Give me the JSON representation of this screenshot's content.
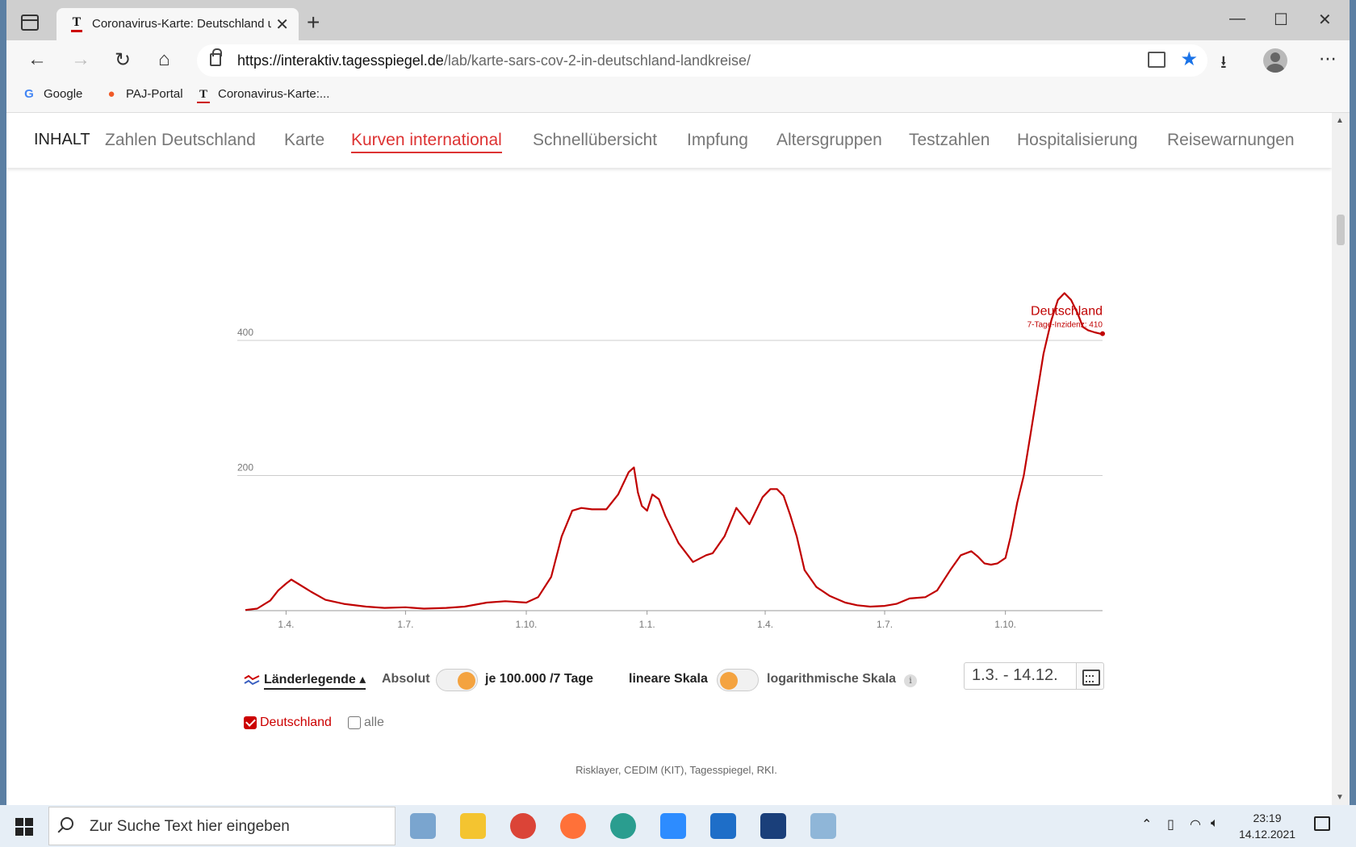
{
  "browser": {
    "tab_title": "Coronavirus-Karte: Deutschland und die Welt",
    "url_host": "https://interaktiv.tagesspiegel.de",
    "url_path": "/lab/karte-sars-cov-2-in-deutschland-landkreise/",
    "bookmarks": [
      "Google",
      "PAJ-Portal",
      "Coronavirus-Karte:..."
    ]
  },
  "nav": {
    "label": "INHALT",
    "items": [
      "Zahlen Deutschland",
      "Karte",
      "Kurven international",
      "Schnellübersicht",
      "Impfung",
      "Altersgruppen",
      "Testzahlen",
      "Hospitalisierung",
      "Reisewarnungen"
    ],
    "active": "Kurven international"
  },
  "controls": {
    "legend_toggle": "Länderlegende ▴",
    "absolut": "Absolut",
    "per100k": "je 100.000 /7 Tage",
    "linear": "lineare Skala",
    "log": "logarithmische Skala",
    "info": "i",
    "date_range": "1.3. - 14.12.",
    "country_checkbox": "Deutschland",
    "all_checkbox": "alle"
  },
  "source": "Risklayer, CEDIM (KIT), Tagesspiegel, RKI.",
  "taskbar": {
    "search_placeholder": "Zur Suche Text hier eingeben",
    "time": "23:19",
    "date": "14.12.2021"
  },
  "colors": {
    "accent": "#c00000",
    "nav_active": "#dd3333",
    "toggle_knob": "#f4a340"
  },
  "chart_data": {
    "type": "line",
    "ylim": [
      0,
      480
    ],
    "yticks": [
      200,
      400
    ],
    "xticks": [
      "1.4.",
      "1.7.",
      "1.10.",
      "1.1.",
      "1.4.",
      "1.7.",
      "1.10."
    ],
    "annotation": {
      "label": "Deutschland",
      "sublabel": "7-Tage-Inzidenz: 410"
    },
    "series": [
      {
        "name": "Deutschland",
        "color": "#c00000",
        "x": [
          "2020-03-01",
          "2020-03-10",
          "2020-03-20",
          "2020-03-26",
          "2020-04-01",
          "2020-04-05",
          "2020-04-10",
          "2020-04-20",
          "2020-05-01",
          "2020-05-15",
          "2020-06-01",
          "2020-06-15",
          "2020-07-01",
          "2020-07-15",
          "2020-08-01",
          "2020-08-15",
          "2020-09-01",
          "2020-09-15",
          "2020-10-01",
          "2020-10-10",
          "2020-10-20",
          "2020-10-28",
          "2020-11-05",
          "2020-11-12",
          "2020-11-20",
          "2020-12-01",
          "2020-12-10",
          "2020-12-18",
          "2020-12-22",
          "2020-12-25",
          "2020-12-28",
          "2021-01-01",
          "2021-01-05",
          "2021-01-10",
          "2021-01-15",
          "2021-01-25",
          "2021-02-05",
          "2021-02-15",
          "2021-02-20",
          "2021-03-01",
          "2021-03-10",
          "2021-03-20",
          "2021-03-30",
          "2021-04-05",
          "2021-04-10",
          "2021-04-15",
          "2021-04-20",
          "2021-04-25",
          "2021-05-01",
          "2021-05-10",
          "2021-05-20",
          "2021-06-01",
          "2021-06-10",
          "2021-06-20",
          "2021-07-01",
          "2021-07-10",
          "2021-07-20",
          "2021-08-01",
          "2021-08-10",
          "2021-08-20",
          "2021-08-28",
          "2021-09-05",
          "2021-09-10",
          "2021-09-15",
          "2021-09-20",
          "2021-09-25",
          "2021-10-01",
          "2021-10-05",
          "2021-10-10",
          "2021-10-15",
          "2021-10-20",
          "2021-10-25",
          "2021-10-30",
          "2021-11-05",
          "2021-11-10",
          "2021-11-15",
          "2021-11-20",
          "2021-11-25",
          "2021-11-29",
          "2021-12-03",
          "2021-12-08",
          "2021-12-12",
          "2021-12-14"
        ],
        "y": [
          1,
          3,
          15,
          30,
          40,
          46,
          40,
          28,
          16,
          10,
          6,
          4,
          5,
          3,
          4,
          6,
          12,
          14,
          12,
          20,
          50,
          110,
          148,
          152,
          150,
          150,
          172,
          205,
          212,
          175,
          155,
          148,
          172,
          165,
          140,
          100,
          72,
          82,
          85,
          110,
          152,
          128,
          168,
          180,
          180,
          170,
          142,
          110,
          60,
          35,
          22,
          12,
          8,
          6,
          7,
          10,
          18,
          20,
          30,
          60,
          82,
          88,
          80,
          70,
          68,
          70,
          78,
          110,
          160,
          200,
          260,
          320,
          380,
          430,
          460,
          470,
          460,
          440,
          420,
          415,
          412,
          410,
          410
        ]
      }
    ]
  }
}
